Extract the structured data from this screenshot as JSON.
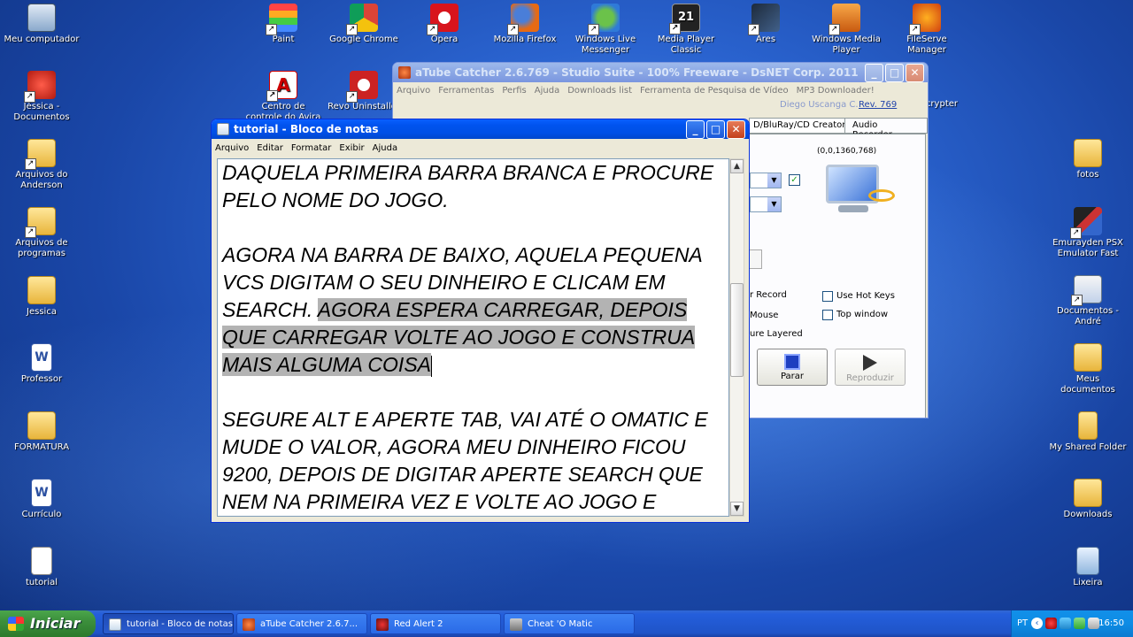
{
  "desktop_icons": {
    "meu_computador": "Meu computador",
    "paint": "Paint",
    "chrome": "Google Chrome",
    "opera": "Opera",
    "firefox": "Mozilla Firefox",
    "msn": "Windows Live Messenger",
    "mpc": "Media Player Classic",
    "ares": "Ares",
    "wmp": "Windows Media Player",
    "fileserve": "FileServe Manager",
    "jessica_docs": "Jéssica - Documentos",
    "avira": "Centro de controle do Avira AntiVir",
    "revo": "Revo Uninstaller",
    "encrypter": "crypter",
    "arquivos_anderson": "Arquivos do Anderson",
    "arquivos_programas": "Arquivos de programas",
    "jessica": "Jessica",
    "professor": "Professor",
    "formatura": "FORMATURA",
    "curriculo": "Currículo",
    "tutorial": "tutorial",
    "fotos": "fotos",
    "emurayden": "Emurayden PSX Emulator Fast",
    "documentos_andre": "Documentos - André",
    "meus_documentos": "Meus documentos",
    "shared_folder": "My Shared Folder",
    "downloads": "Downloads",
    "lixeira": "Lixeira"
  },
  "atube": {
    "title": "aTube Catcher 2.6.769 - Studio Suite - 100% Freeware - DsNET Corp. 2011",
    "menu": [
      "Arquivo",
      "Ferramentas",
      "Perfis",
      "Ajuda",
      "Downloads list",
      "Ferramenta de Pesquisa de Vídeo",
      "MP3 Downloader!"
    ],
    "author": "Diego Uscanga C.",
    "rev": "Rev. 769",
    "tab_creator": "D/BluRay/CD Creator",
    "tab_audio": "Audio Recorder",
    "coords": "(0,0,1360,768)",
    "record_label": "r Record",
    "mouse_label": "Mouse",
    "layered_label": "ure Layered",
    "hotkeys_label": "Use Hot Keys",
    "topwindow_label": "Top window",
    "stop_label": "Parar",
    "play_label": "Reproduzir"
  },
  "notepad": {
    "title": "tutorial - Bloco de notas",
    "menu": [
      "Arquivo",
      "Editar",
      "Formatar",
      "Exibir",
      "Ajuda"
    ],
    "lines": [
      "DAQUELA PRIMEIRA BARRA BRANCA E PROCURE",
      "PELO NOME DO JOGO.",
      "",
      "AGORA NA BARRA DE BAIXO, AQUELA PEQUENA",
      "VCS DIGITAM O SEU DINHEIRO E CLICAM EM"
    ],
    "line6_plain": "SEARCH. ",
    "line6_sel": "AGORA ESPERA CARREGAR, DEPOIS",
    "line7_sel": "QUE CARREGAR VOLTE AO JOGO E CONSTRUA",
    "line8_sel": "MAIS ALGUMA COISA",
    "lines_after": [
      "",
      "SEGURE ALT E APERTE TAB, VAI ATÉ O OMATIC E",
      "MUDE O VALOR, AGORA MEU DINHEIRO FICOU",
      "9200, DEPOIS DE DIGITAR APERTE SEARCH QUE",
      "NEM NA PRIMEIRA VEZ E VOLTE AO JOGO E"
    ]
  },
  "taskbar": {
    "start": "Iniciar",
    "tasks": [
      "tutorial - Bloco de notas",
      "aTube Catcher 2.6.7...",
      "Red Alert 2",
      "Cheat 'O Matic"
    ],
    "lang": "PT",
    "clock": "16:50"
  }
}
